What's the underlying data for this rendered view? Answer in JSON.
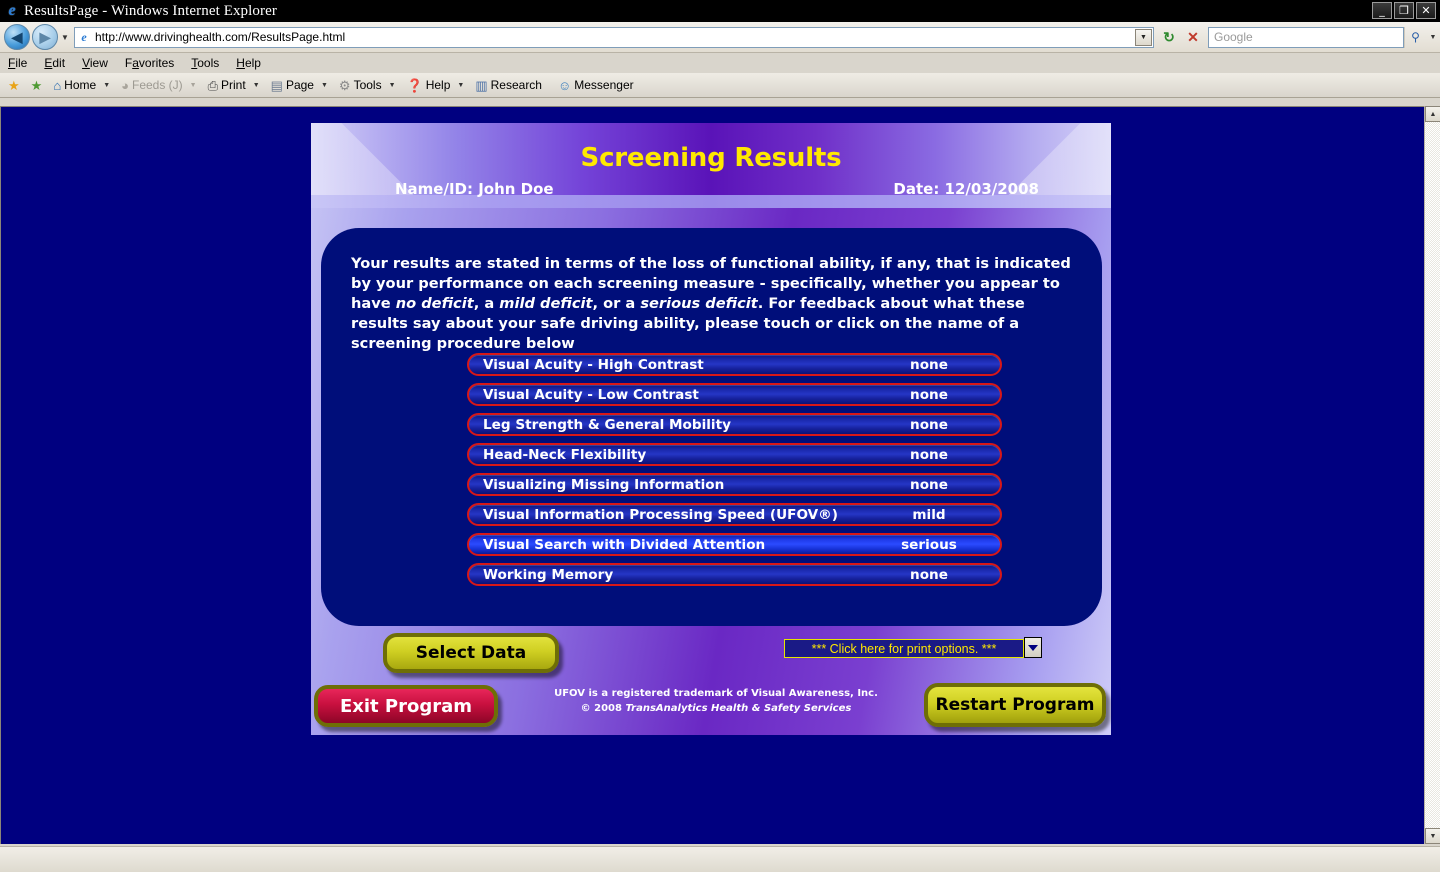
{
  "window": {
    "title": "ResultsPage - Windows Internet Explorer",
    "icon": "ie-logo-icon",
    "minimize_label": "_",
    "maximize_label": "❐",
    "close_label": "✕"
  },
  "address_bar": {
    "back_label": "◀",
    "forward_label": "▶",
    "history_caret": "▼",
    "url": "http://www.drivinghealth.com/ResultsPage.html",
    "url_dropdown_caret": "▼",
    "refresh_label": "↻",
    "stop_label": "✕",
    "search_placeholder": "Google",
    "search_go_label": "⚲",
    "search_go_caret": "▼"
  },
  "menubar": {
    "items": [
      {
        "pre": "",
        "key": "F",
        "post": "ile"
      },
      {
        "pre": "",
        "key": "E",
        "post": "dit"
      },
      {
        "pre": "",
        "key": "V",
        "post": "iew"
      },
      {
        "pre": "F",
        "key": "a",
        "post": "vorites"
      },
      {
        "pre": "",
        "key": "T",
        "post": "ools"
      },
      {
        "pre": "",
        "key": "H",
        "post": "elp"
      }
    ]
  },
  "command_bar": {
    "items": [
      {
        "icon": "star-favorites-icon",
        "glyph": "★",
        "label": "",
        "caret": false,
        "dim": false,
        "color": "#e8a317"
      },
      {
        "icon": "star-add-favorite-icon",
        "glyph": "★",
        "label": "",
        "caret": false,
        "dim": false,
        "color": "#4e9a32"
      },
      {
        "icon": "home-icon",
        "glyph": "⌂",
        "label": "Home",
        "caret": true,
        "dim": false,
        "color": "#2b6cb0"
      },
      {
        "icon": "feeds-icon",
        "glyph": "◕",
        "label": "Feeds (J)",
        "caret": true,
        "dim": true,
        "color": "#a8a49b"
      },
      {
        "icon": "print-icon",
        "glyph": "⎙",
        "label": "Print",
        "caret": true,
        "dim": false,
        "color": "#4a4a4a"
      },
      {
        "icon": "page-icon",
        "glyph": "▤",
        "label": "Page",
        "caret": true,
        "dim": false,
        "color": "#6b7a8f"
      },
      {
        "icon": "tools-gear-icon",
        "glyph": "⚙",
        "label": "Tools",
        "caret": true,
        "dim": false,
        "color": "#8a8a8a"
      },
      {
        "icon": "help-icon",
        "glyph": "❓",
        "label": "Help",
        "caret": true,
        "dim": false,
        "color": "#1b6fc4"
      },
      {
        "icon": "research-icon",
        "glyph": "▥",
        "label": "Research",
        "caret": false,
        "dim": false,
        "color": "#4a6fa5"
      },
      {
        "icon": "messenger-icon",
        "glyph": "☺",
        "label": "Messenger",
        "caret": false,
        "dim": false,
        "color": "#3a7fbf"
      }
    ]
  },
  "scrollbar": {
    "up_label": "▲",
    "down_label": "▼"
  },
  "page": {
    "header": {
      "title": "Screening Results",
      "name_label": "Name/ID:  John Doe",
      "date_label": "Date:  12/03/2008"
    },
    "intro_html": "Your results are stated in terms of the loss of functional ability, if any, that is indicated by your performance on each screening measure - specifically, whether you appear to have <i>no deficit</i>, a <i>mild deficit</i>, or a <i>serious deficit</i>.  For feedback about what these results say about your safe driving ability, please touch or click on the name of a screening procedure below",
    "results": [
      {
        "label": "Visual Acuity - High Contrast",
        "value": "none",
        "severity": "none"
      },
      {
        "label": "Visual Acuity - Low Contrast",
        "value": "none",
        "severity": "none"
      },
      {
        "label": "Leg Strength & General Mobility",
        "value": "none",
        "severity": "none"
      },
      {
        "label": "Head-Neck Flexibility",
        "value": "none",
        "severity": "none"
      },
      {
        "label": "Visualizing Missing Information",
        "value": "none",
        "severity": "none"
      },
      {
        "label": "Visual Information Processing Speed (UFOV®)",
        "value": "mild",
        "severity": "mild"
      },
      {
        "label": "Visual Search with Divided Attention",
        "value": "serious",
        "severity": "serious"
      },
      {
        "label": "Working Memory",
        "value": "none",
        "severity": "none"
      }
    ],
    "buttons": {
      "select_data": "Select Data",
      "exit_program": "Exit Program",
      "restart_program": "Restart Program"
    },
    "print_options": {
      "label": "***   Click here for print options.   ***",
      "caret": "▼"
    },
    "footer": {
      "line1": "UFOV is a registered trademark of Visual Awareness, Inc.",
      "line2_prefix": "© 2008  ",
      "line2_italic": "TransAnalytics Health & Safety Services"
    }
  },
  "colors": {
    "title_yellow": "#ffe800",
    "panel_navy": "#000e7a",
    "bar_border_red": "#d81717",
    "serious_blue": "#2b4bff",
    "button_yellow": "#cfcf22",
    "button_red": "#c8103f",
    "viewport_navy": "#000080"
  }
}
